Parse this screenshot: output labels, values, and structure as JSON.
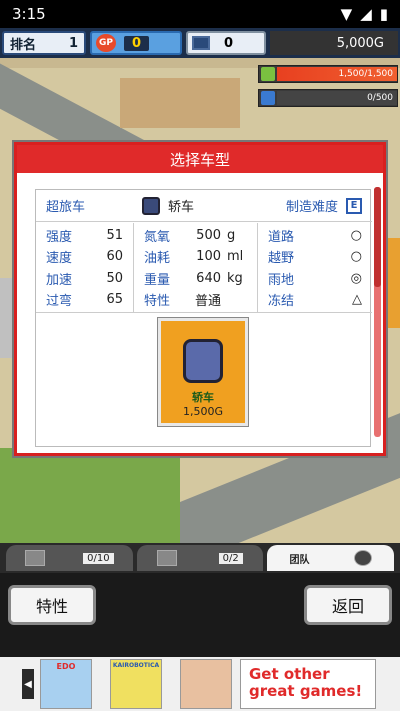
{
  "status": {
    "time": "3:15"
  },
  "topbar": {
    "rank_label": "排名",
    "rank_value": "1",
    "gp_label": "GP",
    "gp_value": "0",
    "pc_value": "0",
    "money": "5,000G"
  },
  "meters": {
    "m1_text": "1,500/1,500",
    "m2_text": "0/500"
  },
  "dialog": {
    "title": "选择车型",
    "car_type": "超旅车",
    "car_name": "轿车",
    "difficulty_label": "制造难度",
    "difficulty_value": "E",
    "stats_left": [
      {
        "label": "强度",
        "value": "51"
      },
      {
        "label": "速度",
        "value": "60"
      },
      {
        "label": "加速",
        "value": "50"
      },
      {
        "label": "过弯",
        "value": "65"
      }
    ],
    "stats_mid": [
      {
        "label": "氮氧",
        "value": "500",
        "unit": "g"
      },
      {
        "label": "油耗",
        "value": "100",
        "unit": "ml"
      },
      {
        "label": "重量",
        "value": "640",
        "unit": "kg"
      },
      {
        "label": "特性",
        "value": "普通",
        "unit": ""
      }
    ],
    "stats_right": [
      {
        "label": "道路",
        "value": "○"
      },
      {
        "label": "越野",
        "value": "○"
      },
      {
        "label": "雨地",
        "value": "◎"
      },
      {
        "label": "冻结",
        "value": "△"
      }
    ],
    "card": {
      "name": "轿车",
      "price": "1,500G"
    }
  },
  "tabs": [
    {
      "meter": "0/10"
    },
    {
      "meter": "0/2"
    },
    {
      "label": "团队"
    }
  ],
  "buttons": {
    "trait": "特性",
    "back": "返回"
  },
  "banner": {
    "tile1": "EDO",
    "tile2": "KAIROBOTICA",
    "ad_text": "Get other great games!"
  },
  "colors": {
    "dialog_red": "#e02a2a",
    "card_orange": "#f0a020",
    "label_blue": "#2a5ab0"
  }
}
